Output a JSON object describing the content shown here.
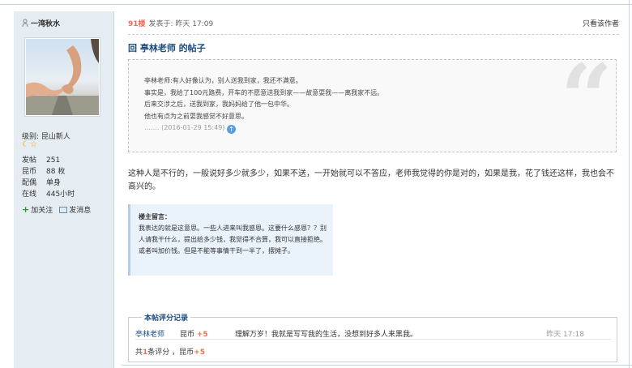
{
  "user": {
    "name": "一湾秋水",
    "level_label": "级别: 昆山新人",
    "stats": [
      {
        "k": "发帖",
        "v": "251"
      },
      {
        "k": "昆币",
        "v": "88 枚"
      },
      {
        "k": "配偶",
        "v": "单身"
      },
      {
        "k": "在线",
        "v": "445小时"
      }
    ],
    "follow_label": "加关注",
    "message_label": "发消息"
  },
  "post": {
    "floor": "91楼",
    "posted_at": "发表于: 昨天 17:09",
    "only_author": "只看该作者",
    "title": "回 亭林老师 的帖子",
    "quote_lines": [
      "亭林老师:有人好像认为，别人送我到家，我还不满意。",
      "事实是，我给了100元路费，开车的不愿意送我到家——故意耍我——离我家不远。",
      "后来交涉之后，送我到家，我妈妈给了他一包中华。",
      "他也有点为之前耍我感觉不好意思。"
    ],
    "quote_time": "……. (2016-01-29 15:49)",
    "body": "这种人是不行的，一般说好多少就多少，如果不送，一开始就可以不答应，老师我觉得的你是对的，如果是我，花了钱还这样，我也会不高兴的。",
    "reply_title": "楼主留言：",
    "reply_text": "我表达的就是这意思。一些人进来叫我感恩。这要什么感恩？？别人请我干什么，提出给多少钱，我觉得不合算，我可以直接拒绝。或者叫加价钱。但是不能等事情干到一半了，摆摊子。"
  },
  "rating": {
    "legend": "本帖评分记录",
    "rows": [
      {
        "user": "亭林老师",
        "currency": "昆币",
        "amount": "+5",
        "reason": "理解万岁！我就是写写我的生活，没想到好多人来黑我。",
        "time": "昨天 17:18"
      }
    ],
    "summary_prefix": "共",
    "summary_count": "1",
    "summary_mid": "条评分 ，昆币",
    "summary_total": "+5"
  },
  "colors": {
    "accent": "#1b4a80",
    "highlight": "#f26c4f",
    "sidebar": "#e5edf2"
  }
}
